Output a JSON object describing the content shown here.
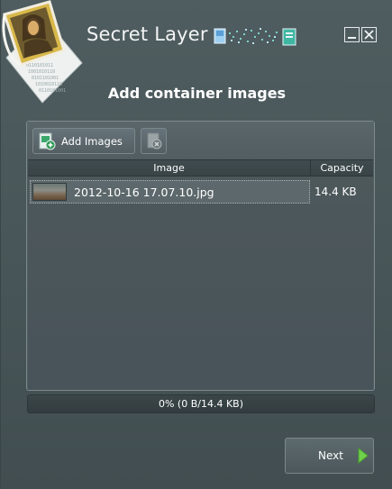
{
  "window": {
    "title": "Secret Layer",
    "heading": "Add container images",
    "controls": {
      "minimize_icon": "minimize-icon",
      "close_icon": "close-icon"
    }
  },
  "toolbar": {
    "add_images_label": "Add Images",
    "add_images_icon": "add-image-icon",
    "remove_icon": "remove-image-icon"
  },
  "table": {
    "columns": [
      "Image",
      "Capacity"
    ],
    "rows": [
      {
        "filename": "2012-10-16 17.07.10.jpg",
        "capacity": "14.4 KB"
      }
    ]
  },
  "progress": {
    "percent": 0,
    "text": "0% (0 B/14.4 KB)"
  },
  "footer": {
    "next_label": "Next",
    "next_icon": "play-arrow-icon"
  },
  "colors": {
    "accent_green": "#5fbf5f",
    "window_bg": "#4a585b",
    "desktop_blue": "#2a8fd0"
  }
}
